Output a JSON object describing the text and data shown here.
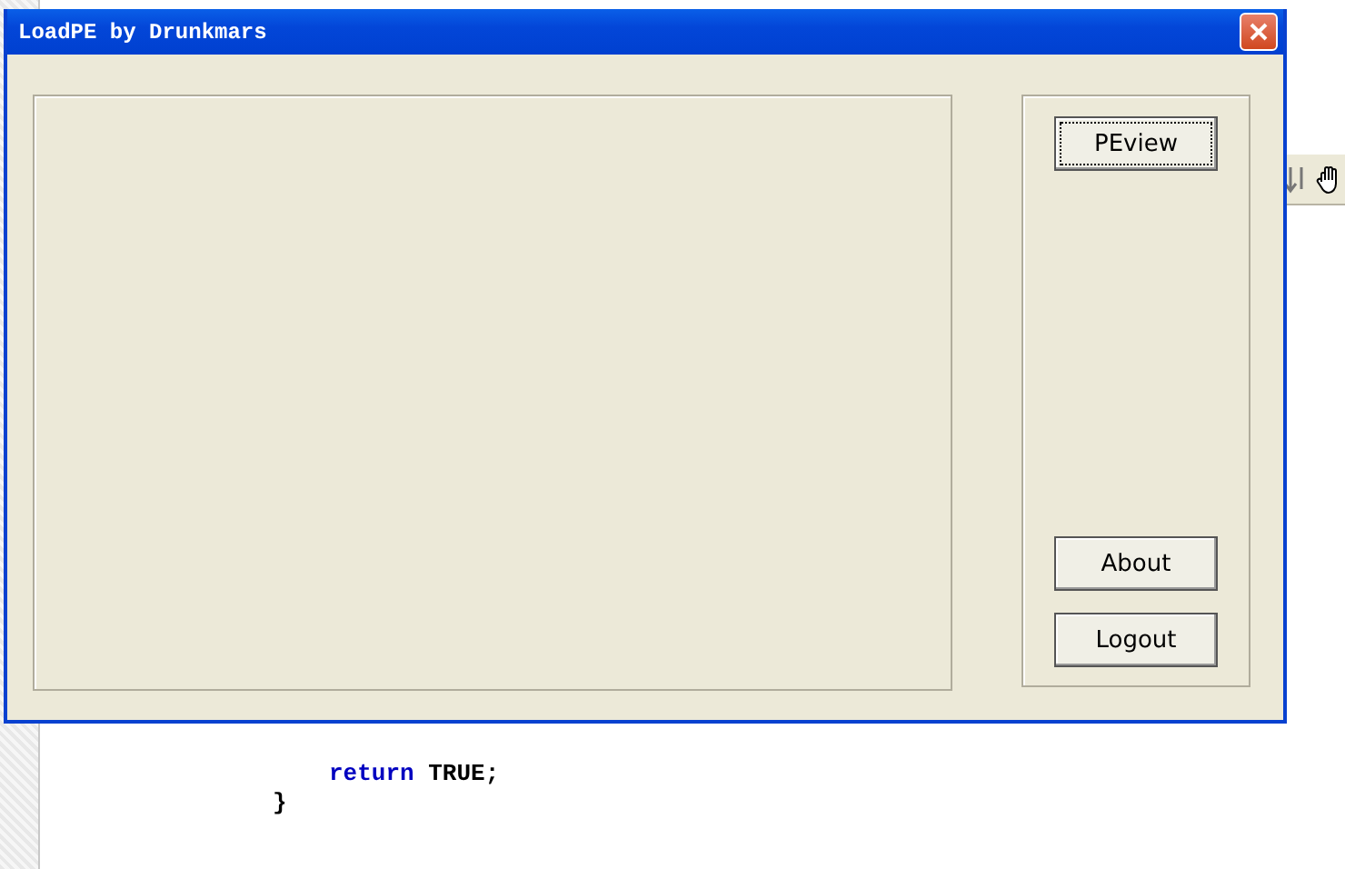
{
  "window": {
    "title": "LoadPE by Drunkmars"
  },
  "buttons": [
    {
      "label": "PEview",
      "focused": true
    },
    {
      "label": "About",
      "focused": false
    },
    {
      "label": "Logout",
      "focused": false
    }
  ],
  "editor": {
    "lines": [
      {
        "children": [
          {
            "keyword": "return",
            "text": " TRUE;"
          }
        ]
      },
      {
        "text": "}"
      }
    ]
  }
}
